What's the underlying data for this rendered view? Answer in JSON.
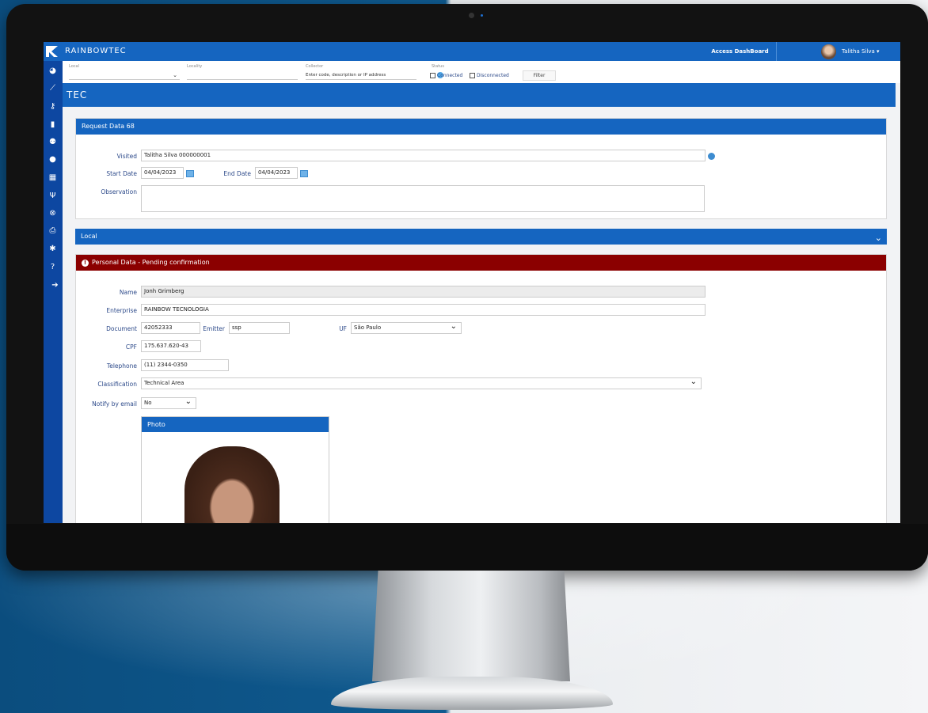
{
  "app": {
    "brand": "RAINBOWTEC",
    "access_dashboard": "Access DashBoard",
    "user_name": "Talitha Silva ▾"
  },
  "filters": {
    "local_label": "Local",
    "locality_label": "Locality",
    "collector_label": "Collector",
    "collector_placeholder": "Enter code, description or IP address",
    "status_label": "Status",
    "connected": "Connected",
    "disconnected": "Disconnected",
    "filter_button": "Filter"
  },
  "banner_title": "TEC",
  "request": {
    "header": "Request Data 68",
    "visited_label": "Visited",
    "visited_value": "Talitha Silva 000000001",
    "start_date_label": "Start Date",
    "start_date": "04/04/2023",
    "end_date_label": "End Date",
    "end_date": "04/04/2023",
    "observation_label": "Observation",
    "observation_value": ""
  },
  "local_header": "Local",
  "personal": {
    "header": "Personal Data - Pending confirmation",
    "name_label": "Name",
    "name": "Jonh Grimberg",
    "enterprise_label": "Enterprise",
    "enterprise": "RAINBOW TECNOLOGIA",
    "document_label": "Document",
    "document": "42052333",
    "emitter_label": "Emitter",
    "emitter": "ssp",
    "uf_label": "UF",
    "uf": "São Paulo",
    "cpf_label": "CPF",
    "cpf": "175.637.620-43",
    "telephone_label": "Telephone",
    "telephone": "(11) 2344-0350",
    "classification_label": "Classification",
    "classification": "Technical Area",
    "notify_label": "Notify by email",
    "notify": "No",
    "photo_header": "Photo"
  },
  "colors": {
    "primary": "#1565c0",
    "sidebar": "#0d47a1",
    "alert": "#8b0000"
  },
  "sidebar_icons": [
    "dashboard-icon",
    "chart-icon",
    "key-icon",
    "document-icon",
    "users-icon",
    "user-icon",
    "calendar-icon",
    "restaurant-icon",
    "cancel-icon",
    "print-icon",
    "settings-icon",
    "help-icon",
    "logout-icon"
  ]
}
